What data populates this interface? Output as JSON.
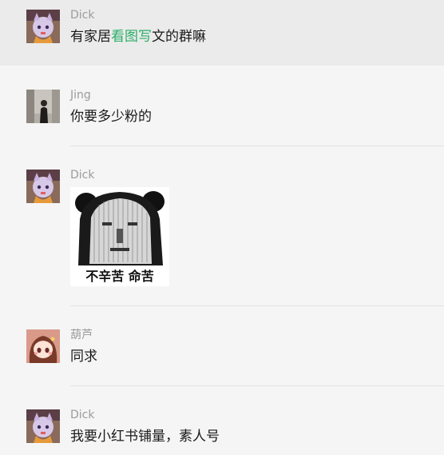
{
  "messages": [
    {
      "sender": "Dick",
      "avatar": "anime-cat-girl-avatar",
      "text_before": "有家居",
      "text_highlight": "看图写",
      "text_after": "文的群嘛",
      "highlight_color": "#2aae67"
    },
    {
      "sender": "Jing",
      "avatar": "photo-person-avatar",
      "text": "你要多少粉的"
    },
    {
      "sender": "Dick",
      "avatar": "anime-cat-girl-avatar",
      "sticker_icon": "panda-meme-sticker",
      "sticker_caption": "不辛苦 命苦"
    },
    {
      "sender": "葫芦",
      "avatar": "chibi-girl-avatar",
      "text": "同求"
    },
    {
      "sender": "Dick",
      "avatar": "anime-cat-girl-avatar",
      "text": "我要小红书铺量，素人号"
    }
  ],
  "colors": {
    "background": "#f5f5f5",
    "selected_row": "#ebebeb",
    "sender_name": "#9b9b9b",
    "message_text": "#1a1a1a"
  }
}
